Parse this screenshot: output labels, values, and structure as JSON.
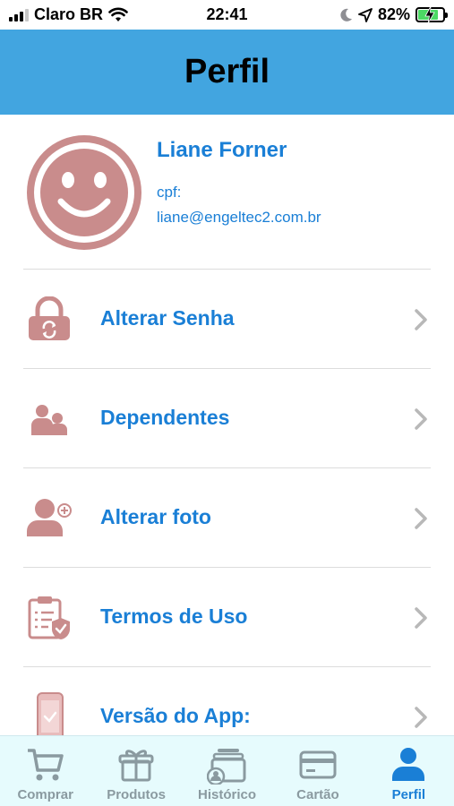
{
  "status_bar": {
    "carrier": "Claro BR",
    "time": "22:41",
    "battery": "82%"
  },
  "header": {
    "title": "Perfil"
  },
  "profile": {
    "name": "Liane Forner",
    "cpf_label": "cpf:",
    "email": "liane@engeltec2.com.br"
  },
  "menu": [
    {
      "label": "Alterar Senha",
      "icon": "lock-icon"
    },
    {
      "label": "Dependentes",
      "icon": "people-icon"
    },
    {
      "label": "Alterar foto",
      "icon": "add-user-icon"
    },
    {
      "label": "Termos de Uso",
      "icon": "clipboard-shield-icon"
    },
    {
      "label": "Versão do App:",
      "icon": "phone-check-icon"
    }
  ],
  "tabbar": [
    {
      "label": "Comprar",
      "icon": "cart-icon",
      "active": false
    },
    {
      "label": "Produtos",
      "icon": "gift-icon",
      "active": false
    },
    {
      "label": "Histórico",
      "icon": "history-icon",
      "active": false
    },
    {
      "label": "Cartão",
      "icon": "card-icon",
      "active": false
    },
    {
      "label": "Perfil",
      "icon": "person-icon",
      "active": true
    }
  ],
  "colors": {
    "header_bg": "#42a5e0",
    "accent_text": "#1a7fd6",
    "icon_rose": "#c98c8c",
    "tabbar_bg": "#e6fbfd"
  }
}
